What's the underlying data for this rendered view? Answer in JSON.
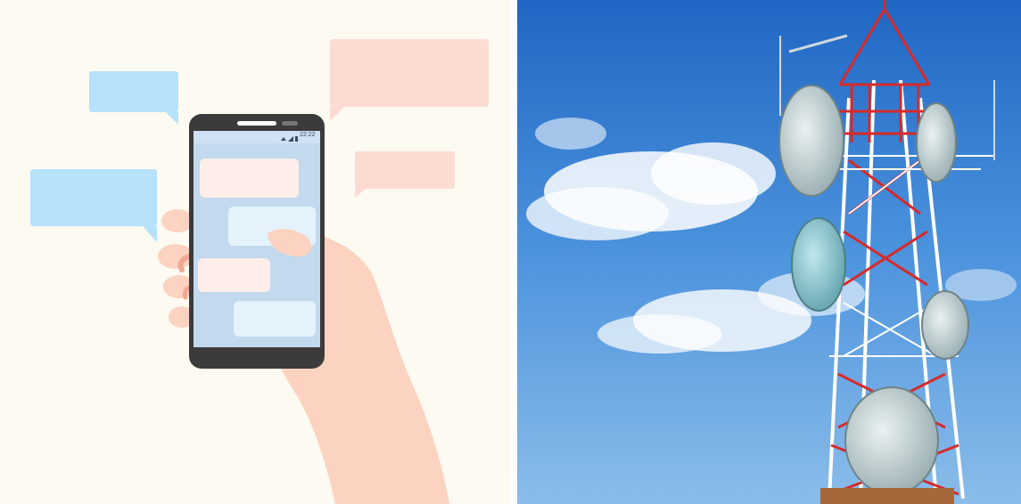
{
  "left_panel": {
    "phone": {
      "status_time": "22:22"
    }
  },
  "right_panel": {}
}
